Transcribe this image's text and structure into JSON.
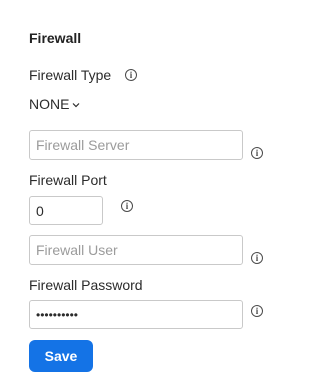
{
  "section": {
    "title": "Firewall"
  },
  "firewall_type": {
    "label": "Firewall Type",
    "value": "NONE"
  },
  "firewall_server": {
    "placeholder": "Firewall Server",
    "value": ""
  },
  "firewall_port": {
    "label": "Firewall Port",
    "value": "0"
  },
  "firewall_user": {
    "placeholder": "Firewall User",
    "value": ""
  },
  "firewall_password": {
    "label": "Firewall Password",
    "value": "••••••••••"
  },
  "actions": {
    "save_label": "Save"
  },
  "colors": {
    "accent": "#1473e6",
    "border": "#c9c9c9",
    "placeholder": "#9b9b9b"
  }
}
